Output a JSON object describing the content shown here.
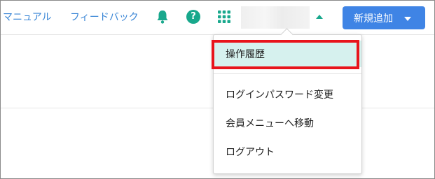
{
  "header": {
    "manual_label": "マニュアル",
    "feedback_label": "フィードバック",
    "add_button_label": "新規追加"
  },
  "menu": {
    "items": [
      {
        "label": "操作履歴"
      },
      {
        "label": "ログインパスワード変更"
      },
      {
        "label": "会員メニューへ移動"
      },
      {
        "label": "ログアウト"
      }
    ]
  },
  "icons": {
    "bell": "bell-icon",
    "help": "help-circle-icon",
    "apps": "apps-grid-icon",
    "caret_up": "caret-up-icon",
    "caret_down": "caret-down-icon"
  },
  "colors": {
    "link": "#3a86d6",
    "teal": "#19a88d",
    "button": "#3f84e5",
    "highlight": "#d6f1ee",
    "annotation": "#e8141b"
  }
}
